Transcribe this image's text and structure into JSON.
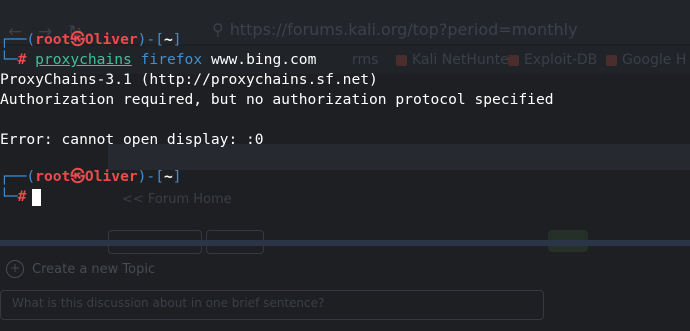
{
  "browser": {
    "nav_icons": [
      "back-arrow-icon",
      "forward-arrow-icon",
      "reload-icon"
    ],
    "url": "https://forums.kali.org/top?period=monthly",
    "url_host": "kali.org",
    "bookmarks": [
      "rms",
      "Kali NetHunter",
      "Exploit-DB",
      "Google H"
    ],
    "forum_home": "<< Forum Home",
    "create_topic": "Create a new Topic",
    "topic_placeholder": "What is this discussion about in one brief sentence?"
  },
  "terminal": {
    "prompt1": {
      "open": "┌──(",
      "user": "root",
      "at_glyph": "㉿",
      "host": "Oliver",
      "sep": ")-[",
      "dir": "~",
      "close": "]",
      "leg": "└─",
      "hash": "#",
      "command": "proxychains",
      "arg1": "firefox",
      "arg2": "www.bing.com"
    },
    "output": [
      "ProxyChains-3.1 (http://proxychains.sf.net)",
      "Authorization required, but no authorization protocol specified",
      "",
      "Error: cannot open display: :0"
    ],
    "prompt2": {
      "open": "┌──(",
      "user": "root",
      "at_glyph": "㉿",
      "host": "Oliver",
      "sep": ")-[",
      "dir": "~",
      "close": "]",
      "leg": "└─",
      "hash": "#"
    }
  }
}
